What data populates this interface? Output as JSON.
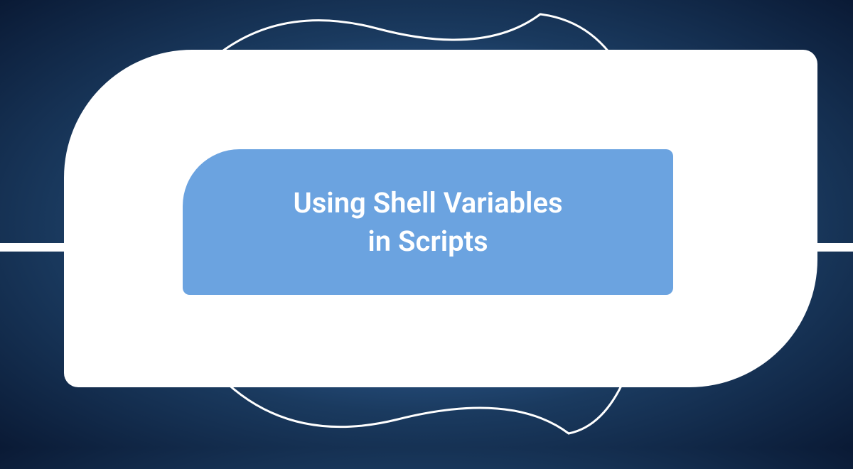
{
  "title_line1": "Using Shell Variables",
  "title_line2": "in Scripts",
  "colors": {
    "background_center": "#5a8fc7",
    "background_edge": "#0a1a35",
    "shape_white": "#ffffff",
    "inner_blue": "#6ba3e0",
    "text_white": "#ffffff"
  }
}
